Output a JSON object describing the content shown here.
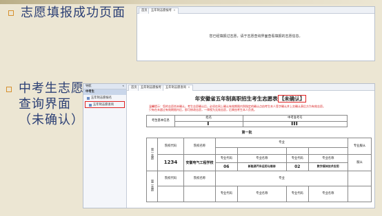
{
  "slide": {
    "label_success": "志愿填报成功页面",
    "label_query": [
      "中考生志愿",
      "查询界面",
      "（未确认）"
    ]
  },
  "shot1": {
    "tabs": [
      "首页",
      "五年制志愿报考"
    ],
    "tab_close": "×",
    "message": "您已经填报过志愿，请于志愿查询界面查看填报的志愿信息。"
  },
  "shot2": {
    "sidebar_header": "导航",
    "sidebar_collapse": "«",
    "sidebar_section": "中考生",
    "sidebar_items": [
      "五年制志愿报名",
      "五年制志愿查询"
    ],
    "tabs": [
      "首页",
      "五年制志愿报考",
      "五年制志愿查询"
    ],
    "tab_close": "×",
    "title": "年安徽省五年制高职招生考生志愿表",
    "title_status": "【未确认】",
    "warning_line1": "温馨提示：您的志愿尚未确认，考生志愿确认后，必须在网上确认有效期限内到指定的确认点由考生本人签字确认并上交确认表后方为有效志愿。",
    "warning_line2": "只有在未超过有效期限内后，即可修改志愿，一律视为无效志愿，后果由考生本人负责。",
    "info_headers": {
      "examinee": "考生基本信息",
      "name": "姓名",
      "exam_no": "中考准考号"
    },
    "batch_title": "第一批",
    "col_school_code": "院校代码",
    "col_school_name": "院校名称",
    "col_major": "专业",
    "col_adjust": "专业服从",
    "col_major_code": "专业代码",
    "col_major_name": "专业名称",
    "volunteer_1": "第一志愿",
    "volunteer_2": "第二志愿",
    "row1": {
      "school_code": "1234",
      "school_name": "安徽电气工程学校",
      "major1_code": "06",
      "major1_name": "新能源汽车运用与维修",
      "major2_code": "02",
      "major2_name": "数字媒体技术应用",
      "adjust": "服从"
    }
  },
  "colors": {
    "slide_text": "#2a3e74",
    "bullet": "#d6902e",
    "warning_red": "#d81e1e",
    "highlight_box": "#e02020"
  }
}
